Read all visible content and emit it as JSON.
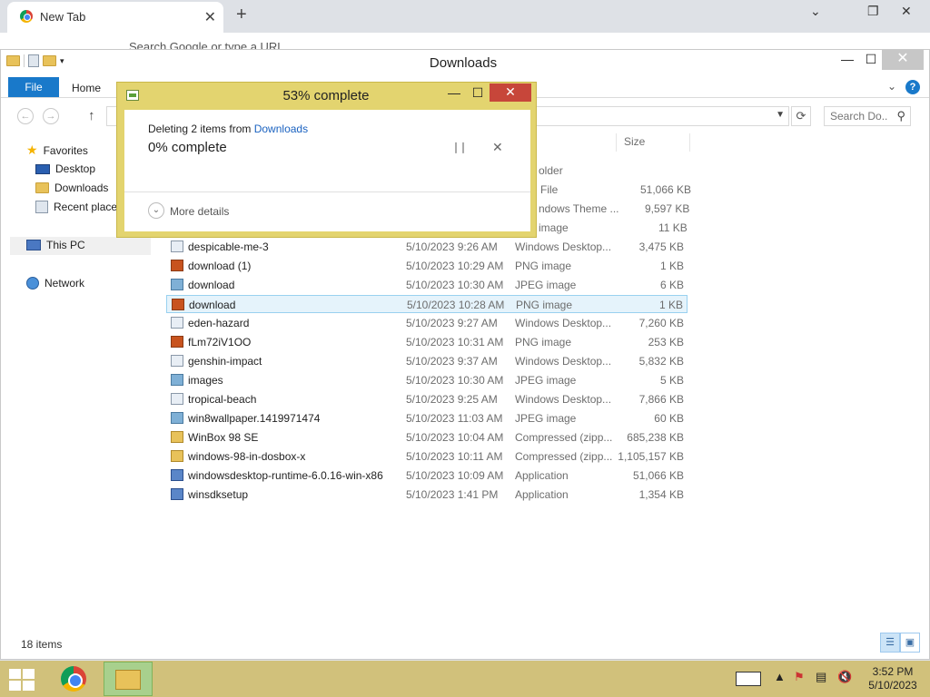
{
  "chrome": {
    "tab_title": "New Tab",
    "tab_close": "✕",
    "new_tab": "+",
    "omnibox_placeholder": "Search Google or type a URL"
  },
  "explorer": {
    "title": "Downloads",
    "ribbon": {
      "file": "File",
      "home": "Home"
    },
    "search_placeholder": "Search Do...",
    "nav": {
      "favorites": "Favorites",
      "desktop": "Desktop",
      "downloads": "Downloads",
      "recent": "Recent places",
      "this_pc": "This PC",
      "network": "Network"
    },
    "columns": {
      "size": "Size"
    },
    "partial_rows": [
      {
        "type": "older",
        "size": ""
      },
      {
        "type": "File",
        "size": "51,066 KB"
      },
      {
        "type": "ndows Theme ...",
        "size": "9,597 KB"
      },
      {
        "type": "image",
        "size": "11 KB"
      }
    ],
    "files": [
      {
        "name": "despicable-me-3",
        "date": "5/10/2023 9:26 AM",
        "type": "Windows Desktop...",
        "size": "3,475 KB",
        "icon": "theme"
      },
      {
        "name": "download (1)",
        "date": "5/10/2023 10:29 AM",
        "type": "PNG image",
        "size": "1 KB",
        "icon": "png"
      },
      {
        "name": "download",
        "date": "5/10/2023 10:30 AM",
        "type": "JPEG image",
        "size": "6 KB",
        "icon": "jpeg"
      },
      {
        "name": "download",
        "date": "5/10/2023 10:28 AM",
        "type": "PNG image",
        "size": "1 KB",
        "icon": "png"
      },
      {
        "name": "eden-hazard",
        "date": "5/10/2023 9:27 AM",
        "type": "Windows Desktop...",
        "size": "7,260 KB",
        "icon": "theme"
      },
      {
        "name": "fLm72iV1OO",
        "date": "5/10/2023 10:31 AM",
        "type": "PNG image",
        "size": "253 KB",
        "icon": "png"
      },
      {
        "name": "genshin-impact",
        "date": "5/10/2023 9:37 AM",
        "type": "Windows Desktop...",
        "size": "5,832 KB",
        "icon": "theme"
      },
      {
        "name": "images",
        "date": "5/10/2023 10:30 AM",
        "type": "JPEG image",
        "size": "5 KB",
        "icon": "jpeg"
      },
      {
        "name": "tropical-beach",
        "date": "5/10/2023 9:25 AM",
        "type": "Windows Desktop...",
        "size": "7,866 KB",
        "icon": "theme"
      },
      {
        "name": "win8wallpaper.1419971474",
        "date": "5/10/2023 11:03 AM",
        "type": "JPEG image",
        "size": "60 KB",
        "icon": "jpeg"
      },
      {
        "name": "WinBox 98 SE",
        "date": "5/10/2023 10:04 AM",
        "type": "Compressed (zipp...",
        "size": "685,238 KB",
        "icon": "zip"
      },
      {
        "name": "windows-98-in-dosbox-x",
        "date": "5/10/2023 10:11 AM",
        "type": "Compressed (zipp...",
        "size": "1,105,157 KB",
        "icon": "zip"
      },
      {
        "name": "windowsdesktop-runtime-6.0.16-win-x86",
        "date": "5/10/2023 10:09 AM",
        "type": "Application",
        "size": "51,066 KB",
        "icon": "app"
      },
      {
        "name": "winsdksetup",
        "date": "5/10/2023 1:41 PM",
        "type": "Application",
        "size": "1,354 KB",
        "icon": "app"
      }
    ],
    "status": "18 items"
  },
  "dialog": {
    "title": "53% complete",
    "line1_prefix": "Deleting 2 items from ",
    "line1_link": "Downloads",
    "line2": "0% complete",
    "more_details": "More details"
  },
  "taskbar": {
    "time": "3:52 PM",
    "date": "5/10/2023"
  }
}
